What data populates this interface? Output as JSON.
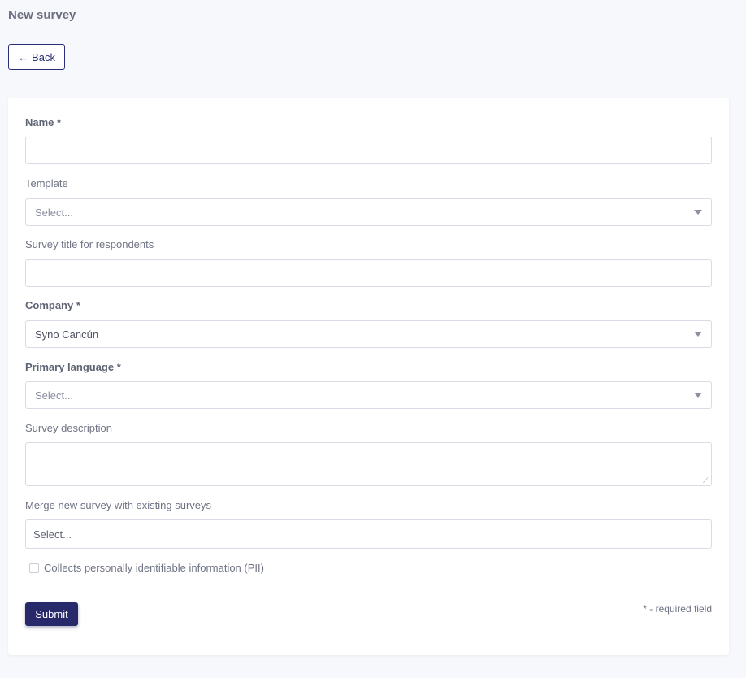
{
  "page": {
    "title": "New survey"
  },
  "back_button": {
    "arrow": "←",
    "label": "Back"
  },
  "form": {
    "name": {
      "label": "Name *",
      "value": ""
    },
    "template": {
      "label": "Template",
      "placeholder": "Select..."
    },
    "survey_title": {
      "label": "Survey title for respondents",
      "value": ""
    },
    "company": {
      "label": "Company *",
      "value": "Syno Cancún"
    },
    "primary_language": {
      "label": "Primary language *",
      "placeholder": "Select..."
    },
    "description": {
      "label": "Survey description",
      "value": ""
    },
    "merge": {
      "label": "Merge new survey with existing surveys",
      "placeholder": "Select..."
    },
    "pii": {
      "label": "Collects personally identifiable information (PII)",
      "checked": false
    },
    "submit_label": "Submit",
    "required_note": "* - required field"
  },
  "icons": {
    "back": "arrow-left-icon",
    "dropdown": "chevron-down-icon",
    "resize": "resize-handle-icon"
  }
}
